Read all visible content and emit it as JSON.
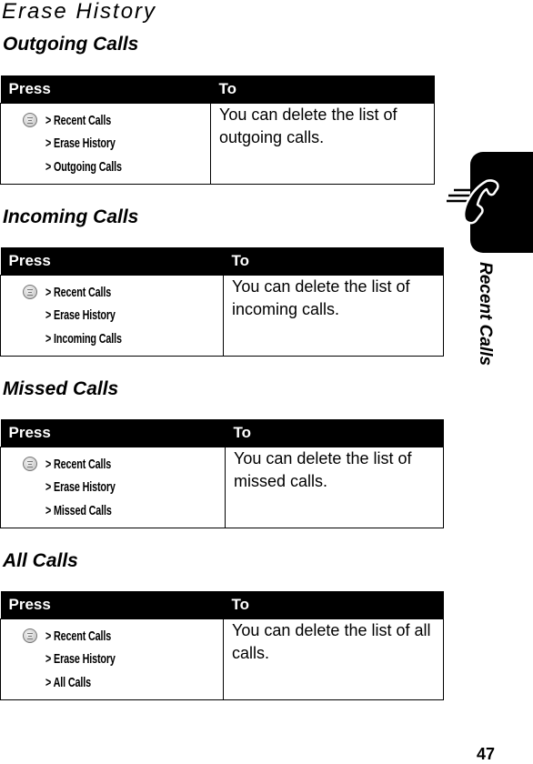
{
  "page": {
    "title": "Erase History",
    "side_tab_label": "Recent Calls",
    "side_tab_icon": "phone-handset-icon",
    "page_number": "47"
  },
  "table_headers": {
    "press": "Press",
    "to": "To"
  },
  "sections": [
    {
      "title": "Outgoing Calls",
      "press_icon": "menu-key-icon",
      "path": [
        "> Recent Calls",
        "> Erase History",
        "> Outgoing Calls"
      ],
      "to": "You can delete the list of outgoing calls."
    },
    {
      "title": "Incoming Calls",
      "press_icon": "menu-key-icon",
      "path": [
        "> Recent Calls",
        "> Erase History",
        "> Incoming Calls"
      ],
      "to": "You can delete the list of incoming calls."
    },
    {
      "title": "Missed Calls",
      "press_icon": "menu-key-icon",
      "path": [
        "> Recent Calls",
        "> Erase History",
        "> Missed Calls"
      ],
      "to": "You can delete the list of missed calls."
    },
    {
      "title": "All Calls",
      "press_icon": "menu-key-icon",
      "path": [
        "> Recent Calls",
        "> Erase History",
        "> All Calls"
      ],
      "to": "You can delete the list of all calls."
    }
  ]
}
